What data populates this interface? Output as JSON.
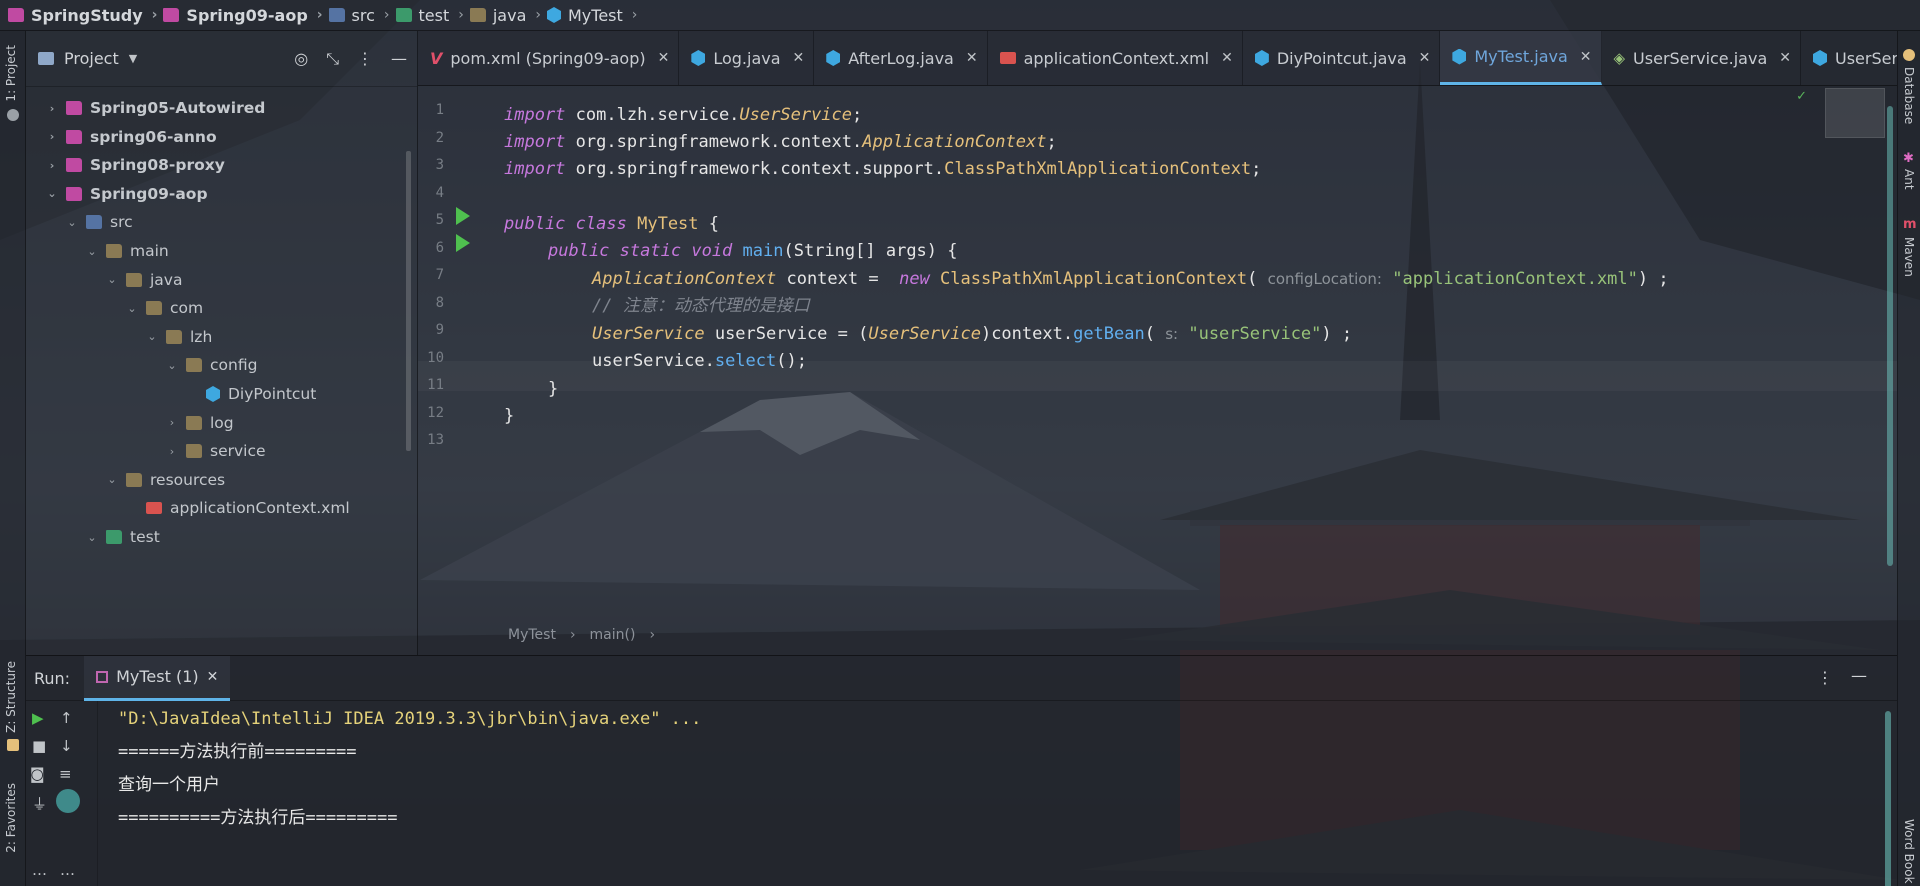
{
  "breadcrumb": [
    {
      "label": "SpringStudy",
      "icon": "module-icon",
      "bold": true
    },
    {
      "label": "Spring09-aop",
      "icon": "module-icon",
      "bold": true
    },
    {
      "label": "src",
      "icon": "source-folder-icon"
    },
    {
      "label": "test",
      "icon": "test-folder-icon"
    },
    {
      "label": "java",
      "icon": "folder-icon"
    },
    {
      "label": "MyTest",
      "icon": "java-class-icon"
    }
  ],
  "left_strip": {
    "project": "1: Project",
    "structure": "Z: Structure",
    "favorites": "2: Favorites"
  },
  "right_strip": {
    "database": "Database",
    "ant": "Ant",
    "maven": "Maven",
    "word_book": "Word Book"
  },
  "project_panel": {
    "title": "Project",
    "tree": [
      {
        "label": "Spring05-Autowired",
        "depth": 0,
        "arrow": "›",
        "icon": "module",
        "bold": true
      },
      {
        "label": "spring06-anno",
        "depth": 0,
        "arrow": "›",
        "icon": "module",
        "bold": true
      },
      {
        "label": "Spring08-proxy",
        "depth": 0,
        "arrow": "›",
        "icon": "module",
        "bold": true
      },
      {
        "label": "Spring09-aop",
        "depth": 0,
        "arrow": "⌄",
        "icon": "module",
        "bold": true
      },
      {
        "label": "src",
        "depth": 1,
        "arrow": "⌄",
        "icon": "src"
      },
      {
        "label": "main",
        "depth": 2,
        "arrow": "⌄",
        "icon": "folder"
      },
      {
        "label": "java",
        "depth": 3,
        "arrow": "⌄",
        "icon": "folder"
      },
      {
        "label": "com",
        "depth": 4,
        "arrow": "⌄",
        "icon": "folder"
      },
      {
        "label": "lzh",
        "depth": 5,
        "arrow": "⌄",
        "icon": "folder"
      },
      {
        "label": "config",
        "depth": 6,
        "arrow": "⌄",
        "icon": "folder"
      },
      {
        "label": "DiyPointcut",
        "depth": 7,
        "arrow": "",
        "icon": "class"
      },
      {
        "label": "log",
        "depth": 6,
        "arrow": "›",
        "icon": "folder"
      },
      {
        "label": "service",
        "depth": 6,
        "arrow": "›",
        "icon": "folder"
      },
      {
        "label": "resources",
        "depth": 3,
        "arrow": "⌄",
        "icon": "resources"
      },
      {
        "label": "applicationContext.xml",
        "depth": 4,
        "arrow": "",
        "icon": "xml"
      },
      {
        "label": "test",
        "depth": 2,
        "arrow": "⌄",
        "icon": "test"
      }
    ]
  },
  "tabs": [
    {
      "label": "pom.xml (Spring09-aop)",
      "icon": "maven-icon",
      "active": false
    },
    {
      "label": "Log.java",
      "icon": "java-class-icon",
      "active": false
    },
    {
      "label": "AfterLog.java",
      "icon": "java-class-icon",
      "active": false
    },
    {
      "label": "applicationContext.xml",
      "icon": "xml-icon",
      "active": false
    },
    {
      "label": "DiyPointcut.java",
      "icon": "java-class-icon",
      "active": false
    },
    {
      "label": "MyTest.java",
      "icon": "java-class-icon",
      "active": true
    },
    {
      "label": "UserService.java",
      "icon": "interface-icon",
      "active": false
    },
    {
      "label": "UserServiceImpl.java",
      "icon": "java-class-icon",
      "active": false
    }
  ],
  "line_numbers": [
    "1",
    "2",
    "3",
    "4",
    "5",
    "6",
    "7",
    "8",
    "9",
    "10",
    "11",
    "12",
    "13"
  ],
  "code": {
    "l1_kw": "import",
    "l1_rest": " com.lzh.service.",
    "l1_cls": "UserService",
    "l1_end": ";",
    "l2_kw": "import",
    "l2_rest": " org.springframework.context.",
    "l2_cls": "ApplicationContext",
    "l2_end": ";",
    "l3_kw": "import",
    "l3_rest": " org.springframework.context.support.",
    "l3_cls": "ClassPathXmlApplicationContext",
    "l3_end": ";",
    "l5_kw1": "public",
    "l5_kw2": "class",
    "l5_name": "MyTest",
    "l5_brace": " {",
    "l6_kw1": "public",
    "l6_kw2": "static",
    "l6_kw3": "void",
    "l6_fn": "main",
    "l6_rest": "(String[] args) {",
    "l7_type": "ApplicationContext",
    "l7_var": " context = ",
    "l7_new": "new",
    "l7_cls": "ClassPathXmlApplicationContext",
    "l7_open": "(",
    "l7_hint": "configLocation:",
    "l7_str": "\"applicationContext.xml\"",
    "l7_end": ") ;",
    "l8_comment": "// 注意：动态代理的是接口",
    "l9_type": "UserService",
    "l9_var": " userService = (",
    "l9_cast": "UserService",
    "l9_mid": ")context.",
    "l9_fn": "getBean",
    "l9_open": "( ",
    "l9_hint": "s:",
    "l9_str": "\"userService\"",
    "l9_end": ") ;",
    "l10_var": "userService.",
    "l10_fn": "select",
    "l10_end": "();",
    "l11": "}",
    "l12": "}"
  },
  "editor_breadcrumb": {
    "cls": "MyTest",
    "method": "main()"
  },
  "run_panel": {
    "label": "Run:",
    "tab": "MyTest (1)",
    "console": [
      "\"D:\\JavaIdea\\IntelliJ IDEA 2019.3.3\\jbr\\bin\\java.exe\" ...",
      "======方法执行前=========",
      "查询一个用户",
      "==========方法执行后========="
    ]
  },
  "colors": {
    "accent": "#5fb4e8",
    "keyword": "#c678dd",
    "type": "#e5c07b",
    "string": "#98c379",
    "function": "#61afef",
    "comment": "#7f848e"
  }
}
